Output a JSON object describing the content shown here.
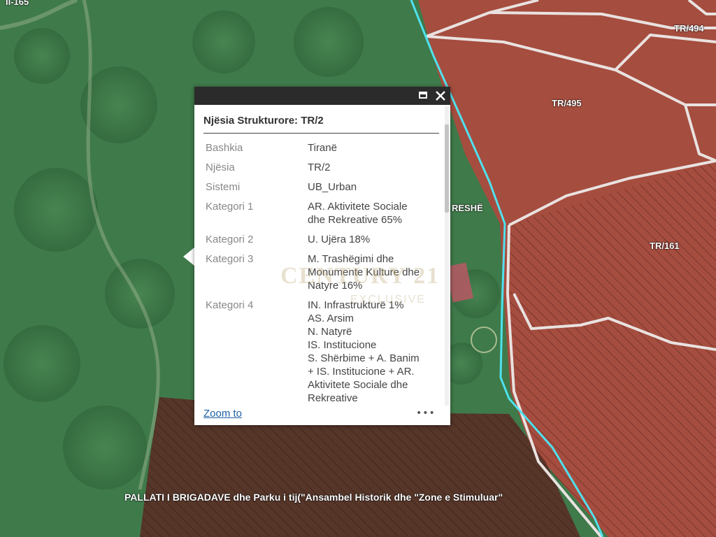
{
  "map": {
    "labels": {
      "top_left_fragment": "II-165",
      "parcel_tr494": "TR/494",
      "parcel_tr495": "TR/495",
      "parcel_tr161": "TR/161",
      "area_fragment": "RESHË",
      "bottom_zone": "PALLATI I BRIGADAVE  dhe Parku i tij(\"Ansambel Historik dhe \"Zone e Stimuluar\""
    },
    "colors": {
      "forest": "#3f7a4a",
      "urban_zone": "#b4473e",
      "historic_zone": "#5a2c24",
      "parcel_outline": "#e9e2e0",
      "road": "#4fe1ef"
    }
  },
  "popup": {
    "title": "Njësia Strukturore: TR/2",
    "controls": {
      "maximize_icon": "maximize-icon",
      "close_icon": "close-icon"
    },
    "attributes": [
      {
        "key": "Bashkia",
        "value": [
          "Tiranë"
        ]
      },
      {
        "key": "Njësia",
        "value": [
          "TR/2"
        ]
      },
      {
        "key": "Sistemi",
        "value": [
          "UB_Urban"
        ]
      },
      {
        "key": "Kategori 1",
        "value": [
          "AR. Aktivitete Sociale",
          "dhe Rekreative 65%"
        ]
      },
      {
        "key": "Kategori 2",
        "value": [
          "U. Ujëra 18%"
        ]
      },
      {
        "key": "Kategori 3",
        "value": [
          "M. Trashëgimi dhe",
          "Monumente Kulture dhe",
          "Natyre 16%"
        ]
      },
      {
        "key": "Kategori 4",
        "value": [
          "IN. Infrastrukturë 1%",
          "AS. Arsim",
          "N. Natyrë",
          "IS. Institucione",
          "S. Shërbime + A. Banim",
          "+ IS. Institucione + AR.",
          "Aktivitete Sociale dhe",
          "Rekreative"
        ]
      }
    ],
    "watermark": "CENTURY 21",
    "watermark_sub": "EXCLUSIVE",
    "footer": {
      "zoom_label": "Zoom to",
      "more_label": "•••"
    }
  }
}
